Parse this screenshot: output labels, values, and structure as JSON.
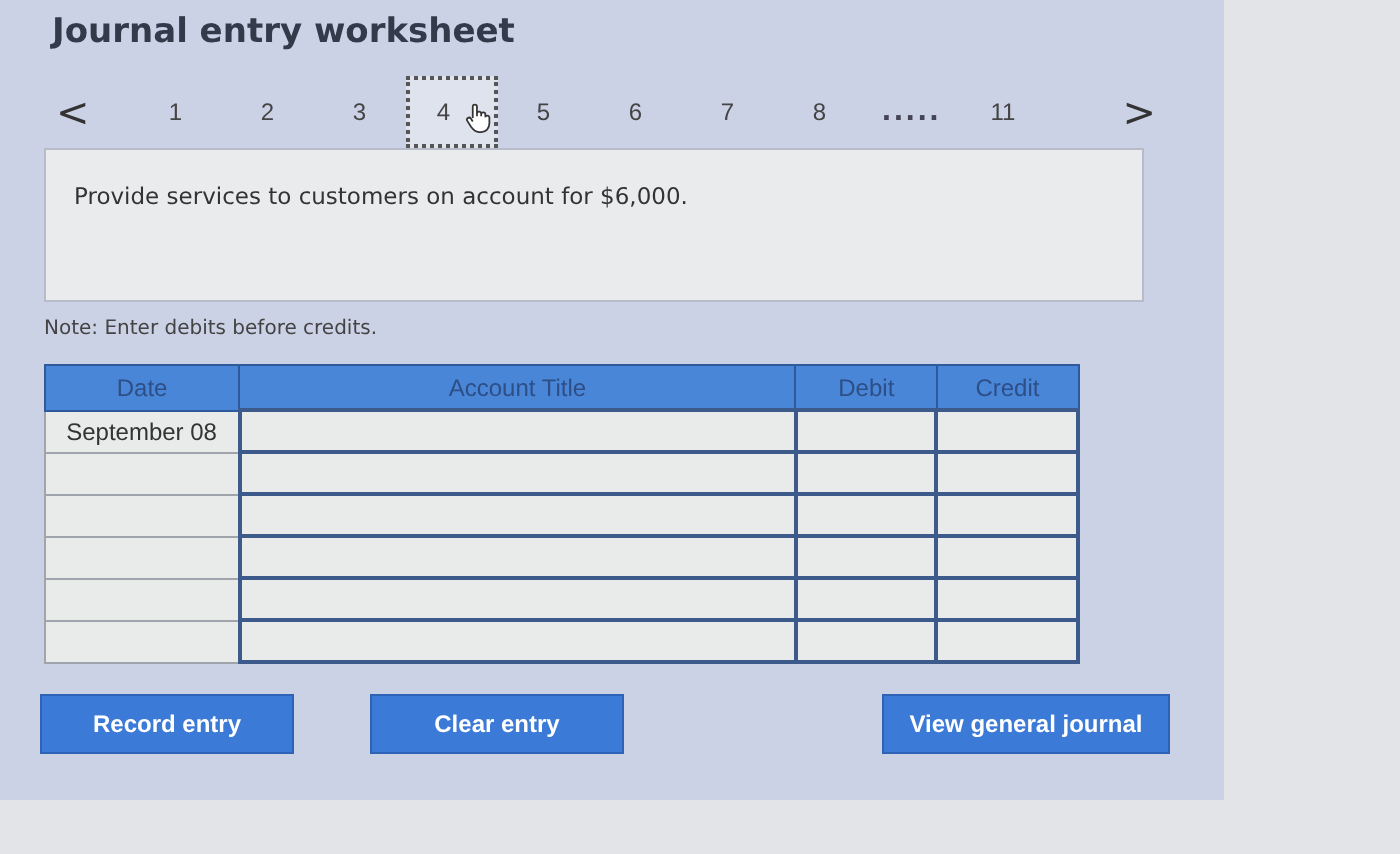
{
  "title": "Journal entry worksheet",
  "pager": {
    "prev": "<",
    "next": ">",
    "pages": [
      {
        "kind": "page",
        "label": "1",
        "selected": false
      },
      {
        "kind": "page",
        "label": "2",
        "selected": false
      },
      {
        "kind": "page",
        "label": "3",
        "selected": false
      },
      {
        "kind": "page",
        "label": "4",
        "selected": true
      },
      {
        "kind": "page",
        "label": "5",
        "selected": false
      },
      {
        "kind": "page",
        "label": "6",
        "selected": false
      },
      {
        "kind": "page",
        "label": "7",
        "selected": false
      },
      {
        "kind": "page",
        "label": "8",
        "selected": false
      },
      {
        "kind": "ellipsis",
        "label": "....."
      },
      {
        "kind": "page",
        "label": "11",
        "selected": false
      }
    ]
  },
  "prompt": "Provide services to customers on account for $6,000.",
  "note": "Note: Enter debits before credits.",
  "table": {
    "columns": [
      "Date",
      "Account Title",
      "Debit",
      "Credit"
    ],
    "rows": [
      {
        "date": "September 08"
      },
      {},
      {},
      {},
      {},
      {}
    ]
  },
  "buttons": [
    "Record entry",
    "Clear entry",
    "View general journal"
  ]
}
